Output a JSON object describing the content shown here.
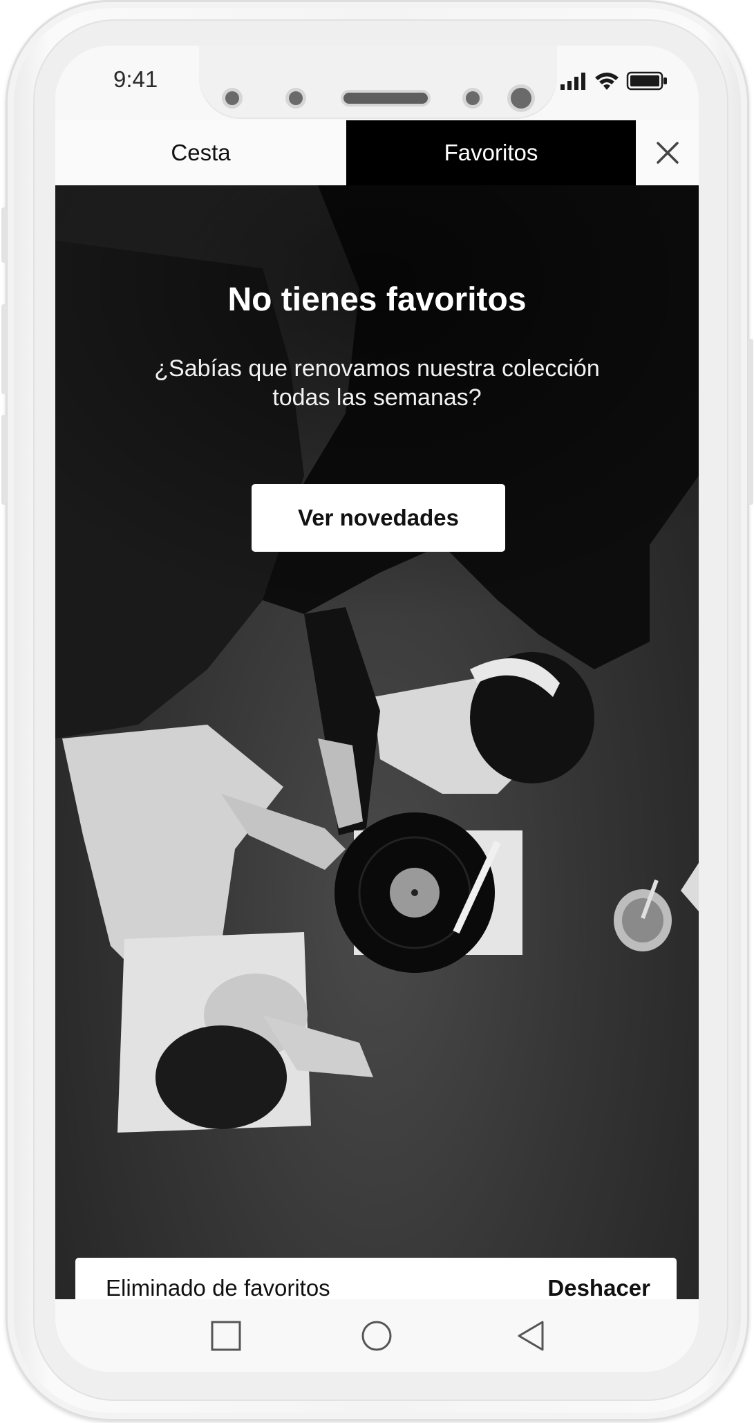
{
  "status_bar": {
    "time": "9:41",
    "icons": [
      "signal-icon",
      "wifi-icon",
      "battery-icon"
    ]
  },
  "tabs": [
    {
      "label": "Cesta",
      "active": false
    },
    {
      "label": "Favoritos",
      "active": true
    }
  ],
  "close_icon": "close-icon",
  "empty_state": {
    "title": "No tienes favoritos",
    "text": "¿Sabías que renovamos nuestra colección todas las semanas?",
    "button_label": "Ver novedades"
  },
  "snackbar": {
    "message": "Eliminado de favoritos",
    "action_label": "Deshacer"
  },
  "nav_bar": {
    "icons": [
      "recents-square-icon",
      "home-circle-icon",
      "back-triangle-icon"
    ]
  },
  "colors": {
    "active_tab_bg": "#000000",
    "inactive_tab_bg": "#fafafa",
    "button_bg": "#ffffff"
  }
}
